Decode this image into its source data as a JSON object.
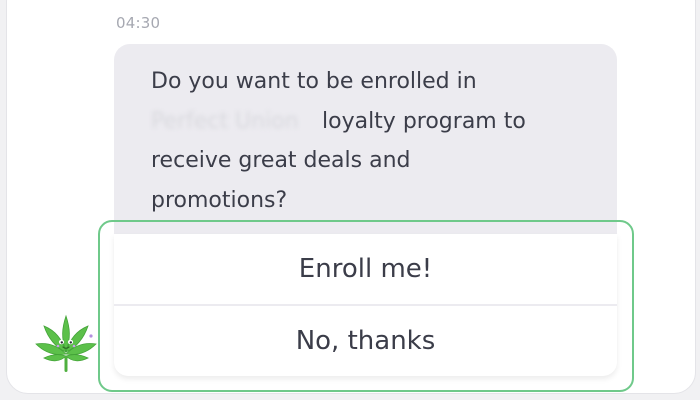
{
  "chat": {
    "timestamp": "04:30",
    "message": {
      "line1": "Do you want to be enrolled in",
      "blurred_brand": "Perfect Union",
      "after_brand": "loyalty program to",
      "line3": "receive great deals and",
      "line4": "promotions?"
    },
    "options": [
      {
        "label": "Enroll me!"
      },
      {
        "label": "No, thanks"
      }
    ]
  },
  "avatar": {
    "icon": "cannabis-leaf-mascot-icon"
  },
  "colors": {
    "bubble_bg": "#ecebf0",
    "text": "#3b3d49",
    "timestamp": "#a6a8b1",
    "focus_ring": "#6fc98a",
    "leaf": "#5cc04a"
  }
}
